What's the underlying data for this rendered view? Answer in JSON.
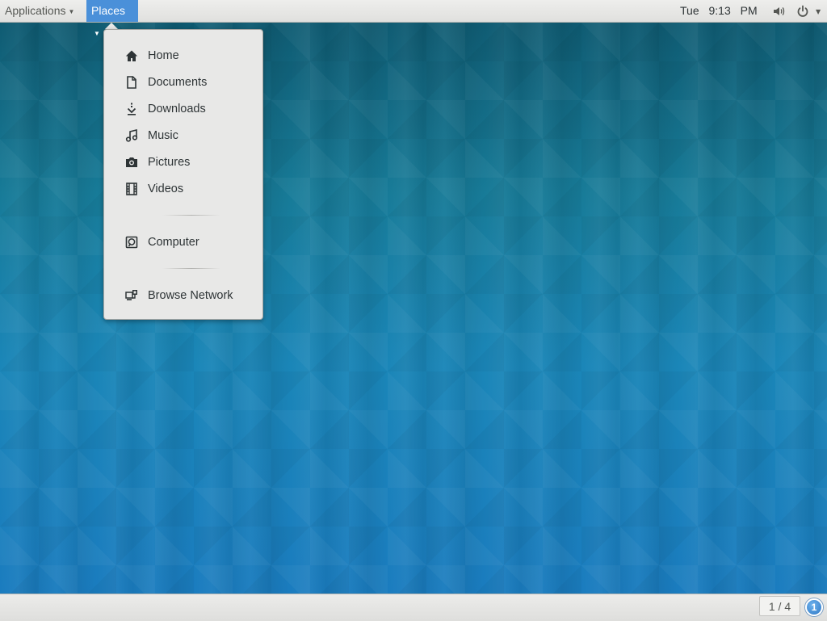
{
  "topbar": {
    "applications_label": "Applications",
    "places_label": "Places",
    "clock": "Tue 9:13 PM",
    "volume_icon": "volume-icon",
    "power_icon": "power-icon"
  },
  "places_menu": {
    "items": [
      {
        "label": "Home",
        "icon": "home-icon"
      },
      {
        "label": "Documents",
        "icon": "document-icon"
      },
      {
        "label": "Downloads",
        "icon": "download-icon"
      },
      {
        "label": "Music",
        "icon": "music-icon"
      },
      {
        "label": "Pictures",
        "icon": "camera-icon"
      },
      {
        "label": "Videos",
        "icon": "film-icon"
      },
      {
        "label": "Computer",
        "icon": "computer-icon"
      },
      {
        "label": "Browse Network",
        "icon": "network-icon"
      }
    ]
  },
  "bottombar": {
    "workspace": "1 / 4",
    "notification_count": "1"
  },
  "colors": {
    "selected_menu": "#4a90d9",
    "panel": "#e8e8e7",
    "text": "#2e3436"
  }
}
